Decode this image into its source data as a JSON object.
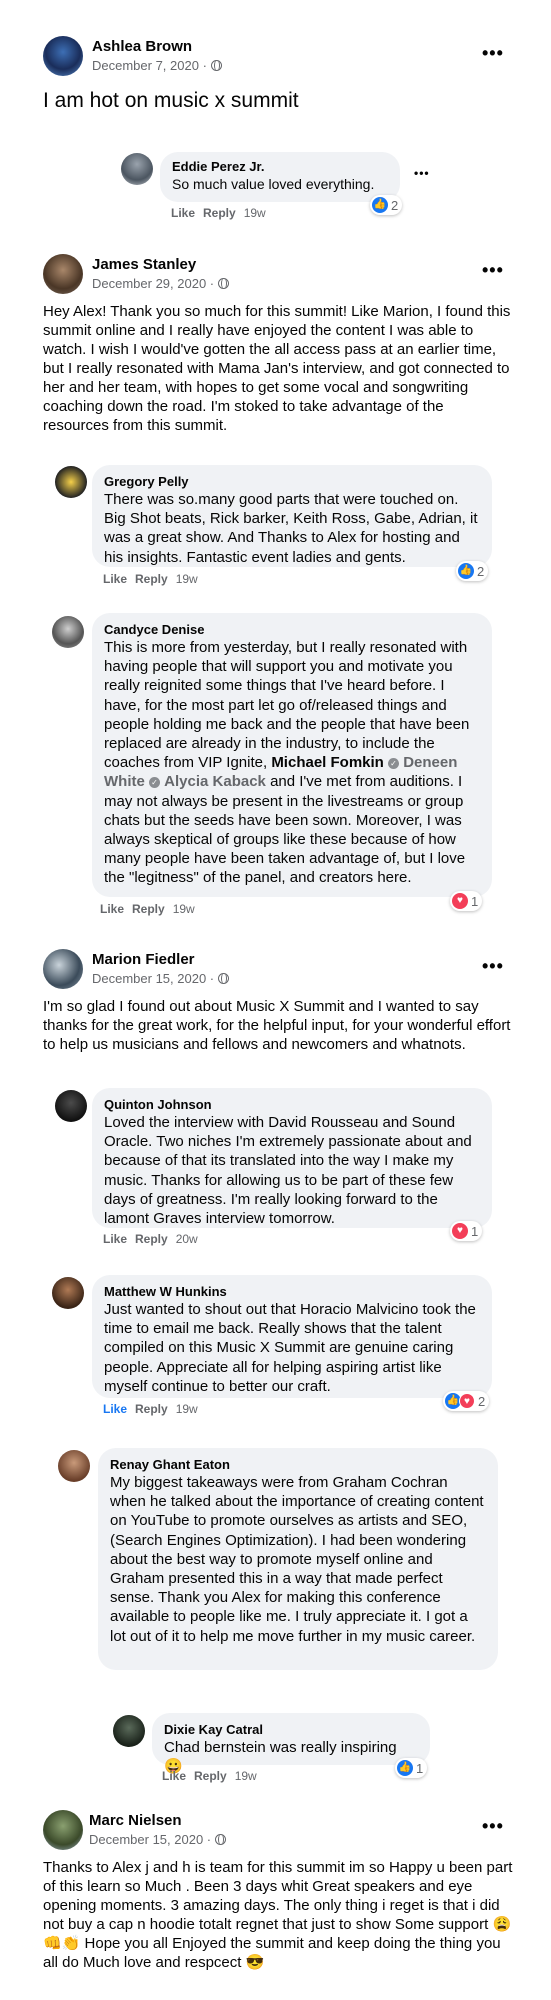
{
  "posts": [
    {
      "name": "Ashlea Brown",
      "date": "December 7, 2020 · ",
      "text": "I am hot on music x summit",
      "replies": [
        {
          "name": "Eddie Perez Jr.",
          "text": "So much value loved everything.",
          "like": "Like",
          "reply": "Reply",
          "time": "19w",
          "reactions": "2"
        }
      ]
    },
    {
      "name": "James Stanley",
      "date": "December 29, 2020 · ",
      "text": "Hey Alex! Thank you so much for this summit! Like Marion, I found this summit  online and I really have enjoyed  the content I was able to watch. I wish I would've gotten the all access pass at an earlier time, but I really resonated with Mama Jan's interview, and got connected to her and her team, with hopes to get some vocal and songwriting coaching down the road. I'm stoked to take advantage of the resources from this summit.",
      "replies": [
        {
          "name": "Gregory Pelly",
          "text": "There was so.many good parts that were touched on. Big Shot beats, Rick barker, Keith Ross, Gabe, Adrian, it was a great show. And Thanks to Alex for hosting and his insights. Fantastic event ladies and gents.",
          "like": "Like",
          "reply": "Reply",
          "time": "19w",
          "reactions": "2"
        },
        {
          "name": "Candyce Denise",
          "text_a": "This is more from yesterday, but I really resonated with having people that will support you and motivate you really reignited some things that I've heard before. I have, for the most part let go of/released things and people holding me back and the people that have been replaced are already in the industry, to include the coaches from VIP Ignite, ",
          "mention1": "Michael Fomkin",
          "mention2": "Deneen White",
          "mention3": "Alycia Kaback",
          "text_b": " and I've met from auditions. I may not always be present in the livestreams or group chats but the seeds have been sown. Moreover, I was always skeptical of groups like these because of how many people have been taken advantage of, but I love the \"legitness\" of the panel, and creators here.",
          "like": "Like",
          "reply": "Reply",
          "time": "19w",
          "reactions": "1"
        }
      ]
    },
    {
      "name": "Marion Fiedler",
      "date": "December 15, 2020 · ",
      "text": "I'm so glad I found out about Music X Summit and I wanted to say thanks for the great work, for the helpful input, for your wonderful effort to help us musicians and fellows and newcomers and whatnots.",
      "replies": [
        {
          "name": "Quinton Johnson",
          "text": "Loved the interview with David Rousseau and Sound Oracle. Two niches I'm extremely passionate about and because of that its translated into the way I make my music. Thanks for allowing us to be part of these few days of greatness. I'm really looking forward to the lamont Graves interview tomorrow.",
          "like": "Like",
          "reply": "Reply",
          "time": "20w",
          "reactions": "1"
        },
        {
          "name": "Matthew W Hunkins",
          "text": "Just wanted to shout out that Horacio Malvicino took the time to email me back. Really shows that the talent compiled on this Music X Summit are genuine caring people. Appreciate all for helping aspiring artist like myself continue to better our craft.",
          "like": "Like",
          "reply": "Reply",
          "time": "19w",
          "reactions": "2"
        },
        {
          "name": "Renay Ghant Eaton",
          "text": "My biggest takeaways were from Graham Cochran when he talked about the importance of creating content on YouTube to promote ourselves as artists and SEO, (Search Engines Optimization). I had been wondering about the best way to promote myself online and Graham presented this in a way that made perfect sense. Thank you Alex for making this conference available to people like me. I truly appreciate it. I got a lot out of it to help me move further in my music career.",
          "like": "",
          "reply": "",
          "time": "",
          "reactions": ""
        },
        {
          "name": "Dixie Kay Catral",
          "text": "Chad bernstein was really inspiring 😀",
          "like": "Like",
          "reply": "Reply",
          "time": "19w",
          "reactions": "1"
        }
      ]
    },
    {
      "name": "Marc Nielsen",
      "date": "December 15, 2020 · ",
      "text": "Thanks to Alex j and h is team for this summit im so Happy u been part of this learn so Much . Been 3 days whit Great speakers and eye opening moments. 3 amazing days. The only thing i reget is that i did not  buy  a cap n hoodie  totalt regnet that just to show Some support 😩👊👏 Hope you all Enjoyed the summit and keep doing the thing you all do Much  love and respcect 😎"
    }
  ],
  "more_icon": "•••",
  "icons": {
    "like": "👍",
    "love": "♥"
  },
  "colors": {
    "link_blue": "#1877f2",
    "love_red": "#f33e58",
    "bubble_bg": "#f0f2f5",
    "muted": "#65676b"
  }
}
